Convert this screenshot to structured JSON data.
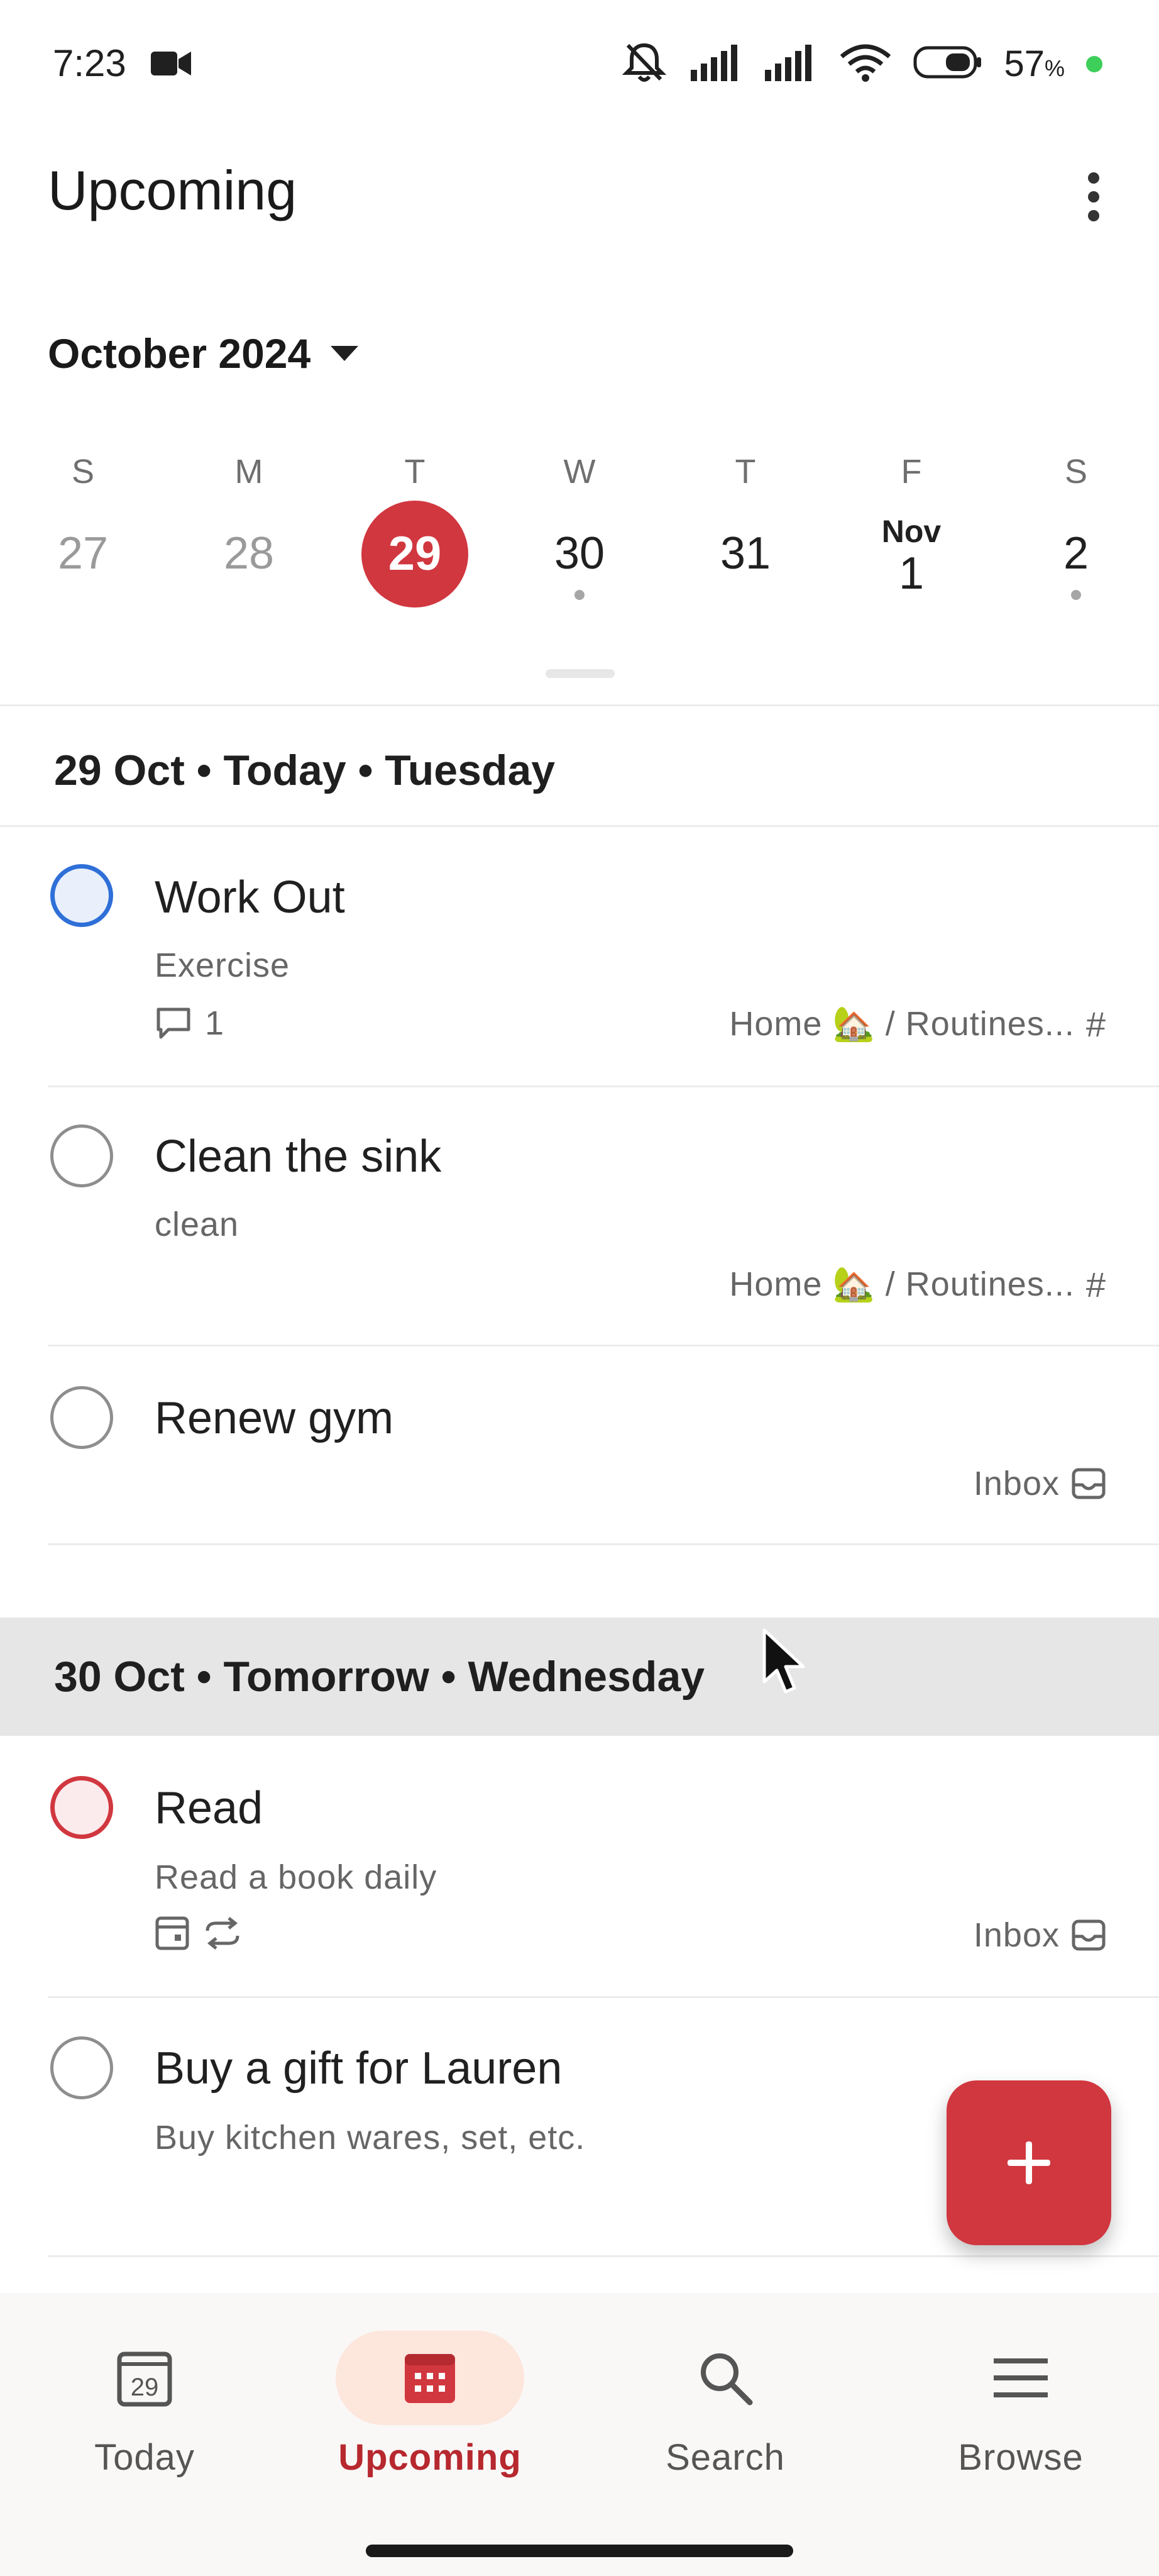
{
  "status_bar": {
    "time": "7:23",
    "battery_percent": "57",
    "battery_unit": "%",
    "icons": [
      "video-camera-icon",
      "muted-bell-icon",
      "signal-icon",
      "signal-icon",
      "wifi-icon",
      "battery-icon",
      "charging-dot-icon"
    ]
  },
  "header": {
    "title": "Upcoming",
    "menu_icon": "vertical-dots-icon"
  },
  "calendar": {
    "month_label": "October 2024",
    "days": [
      {
        "dow": "S",
        "num": "27",
        "month": "",
        "state": "past",
        "dot": false
      },
      {
        "dow": "M",
        "num": "28",
        "month": "",
        "state": "past",
        "dot": false
      },
      {
        "dow": "T",
        "num": "29",
        "month": "",
        "state": "selected",
        "dot": false
      },
      {
        "dow": "W",
        "num": "30",
        "month": "",
        "state": "normal",
        "dot": true
      },
      {
        "dow": "T",
        "num": "31",
        "month": "",
        "state": "normal",
        "dot": false
      },
      {
        "dow": "F",
        "num": "1",
        "month": "Nov",
        "state": "normal",
        "dot": false
      },
      {
        "dow": "S",
        "num": "2",
        "month": "",
        "state": "normal",
        "dot": true
      }
    ]
  },
  "sections": [
    {
      "heading": "29 Oct • Today • Tuesday",
      "tasks": [
        {
          "title": "Work Out",
          "description": "Exercise",
          "comments": "1",
          "project": "Home 🏡 / Routines...",
          "project_icon": "hash-icon",
          "checkbox": "blue"
        },
        {
          "title": "Clean the sink",
          "description": "clean",
          "comments": "",
          "project": "Home 🏡 / Routines...",
          "project_icon": "hash-icon",
          "checkbox": "grey"
        },
        {
          "title": "Renew gym",
          "description": "",
          "comments": "",
          "project": "Inbox",
          "project_icon": "inbox-icon",
          "checkbox": "grey"
        }
      ]
    },
    {
      "heading": "30 Oct • Tomorrow • Wednesday",
      "tasks": [
        {
          "title": "Read",
          "description": "Read a book daily",
          "comments": "",
          "project": "Inbox",
          "project_icon": "inbox-icon",
          "checkbox": "red",
          "meta_icons": [
            "calendar-icon",
            "repeat-icon"
          ]
        },
        {
          "title": "Buy a gift for Lauren",
          "description": "Buy kitchen wares, set, etc.",
          "comments": "",
          "project": "",
          "project_icon": "",
          "checkbox": "grey"
        }
      ]
    }
  ],
  "fab": {
    "icon": "plus-icon"
  },
  "bottom_nav": [
    {
      "label": "Today",
      "icon": "today-calendar-icon",
      "active": false
    },
    {
      "label": "Upcoming",
      "icon": "upcoming-calendar-icon",
      "active": true
    },
    {
      "label": "Search",
      "icon": "search-icon",
      "active": false
    },
    {
      "label": "Browse",
      "icon": "menu-icon",
      "active": false
    }
  ],
  "colors": {
    "accent": "#d1373f",
    "accent_text": "#b7282f",
    "priority_blue": "#2f6fd8",
    "nav_active_bg": "#fde6dc",
    "section_highlight_bg": "#e6e6e6"
  }
}
